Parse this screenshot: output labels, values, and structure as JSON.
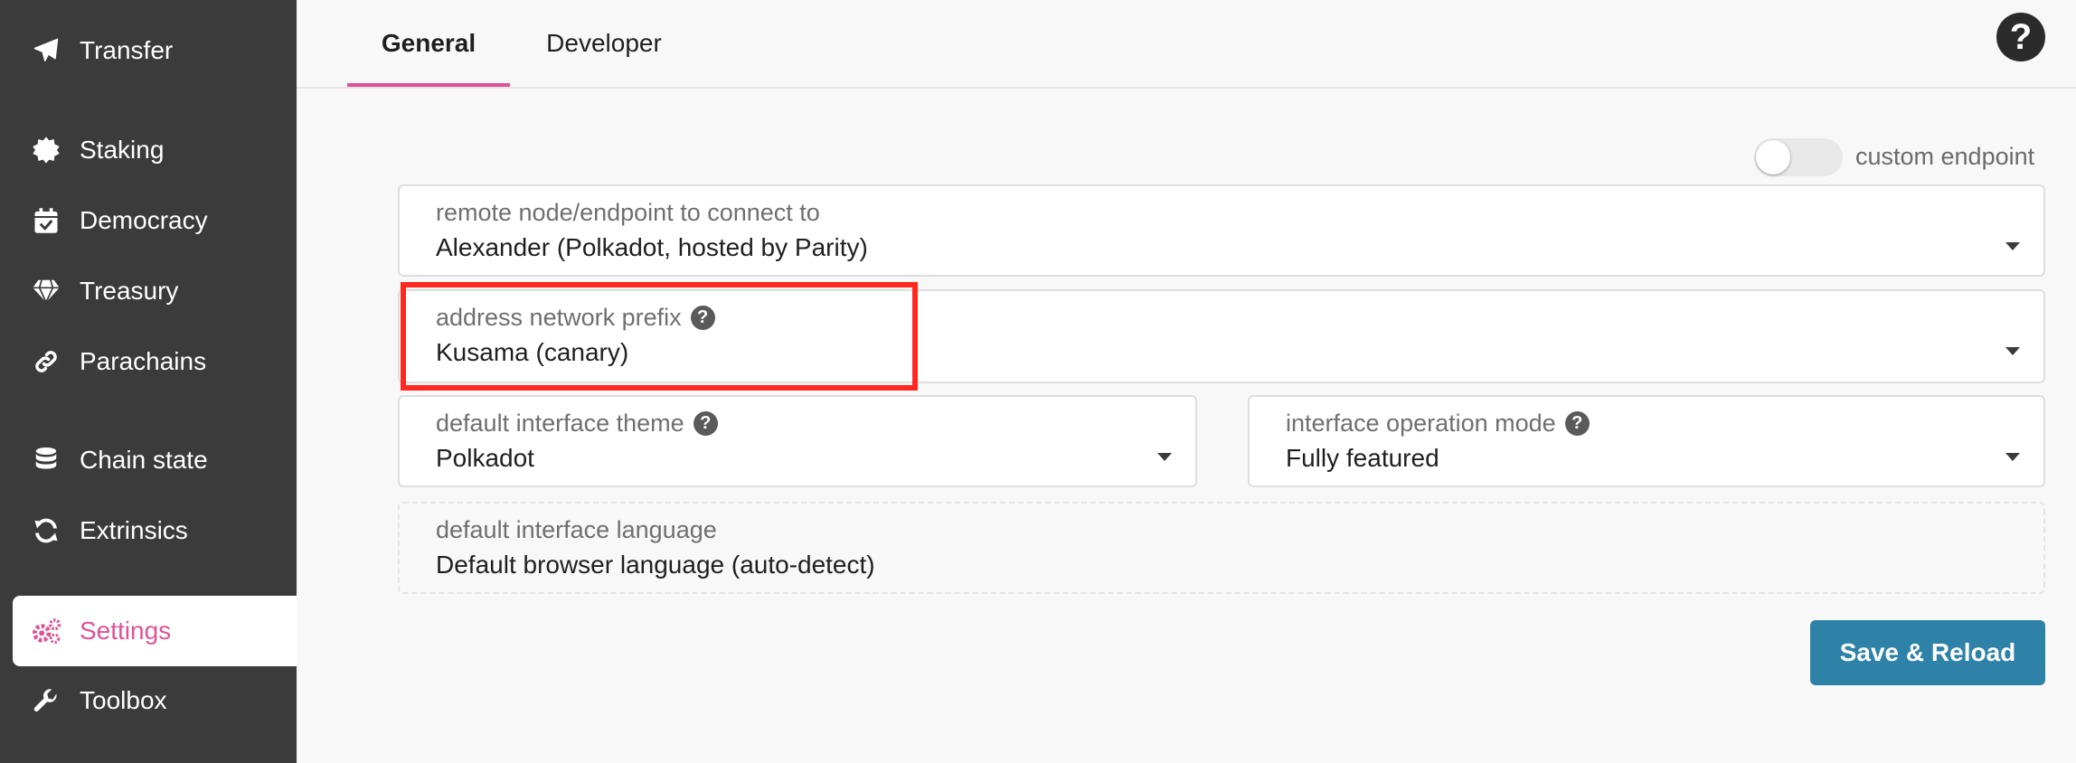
{
  "sidebar": {
    "items": [
      {
        "label": "Transfer",
        "icon": "paper-plane-icon"
      },
      {
        "label": "Staking",
        "icon": "certificate-icon"
      },
      {
        "label": "Democracy",
        "icon": "calendar-check-icon"
      },
      {
        "label": "Treasury",
        "icon": "gem-icon"
      },
      {
        "label": "Parachains",
        "icon": "link-icon"
      },
      {
        "label": "Chain state",
        "icon": "database-icon"
      },
      {
        "label": "Extrinsics",
        "icon": "sync-icon"
      },
      {
        "label": "Settings",
        "icon": "cogs-icon",
        "active": true
      },
      {
        "label": "Toolbox",
        "icon": "wrench-icon"
      }
    ]
  },
  "tabs": [
    {
      "label": "General",
      "active": true
    },
    {
      "label": "Developer"
    }
  ],
  "help": {
    "symbol": "?"
  },
  "custom_endpoint": {
    "label": "custom endpoint",
    "enabled": false
  },
  "fields": {
    "endpoint": {
      "label": "remote node/endpoint to connect to",
      "value": "Alexander (Polkadot, hosted by Parity)"
    },
    "prefix": {
      "label": "address network prefix",
      "value": "Kusama (canary)"
    },
    "theme": {
      "label": "default interface theme",
      "value": "Polkadot"
    },
    "mode": {
      "label": "interface operation mode",
      "value": "Fully featured"
    },
    "language": {
      "label": "default interface language",
      "value": "Default browser language (auto-detect)"
    }
  },
  "save_button": {
    "label": "Save & Reload"
  },
  "colors": {
    "accent": "#e05296",
    "sidebar": "#3b3b3b",
    "button": "#2e82a8",
    "highlight": "#ff2a1f"
  }
}
